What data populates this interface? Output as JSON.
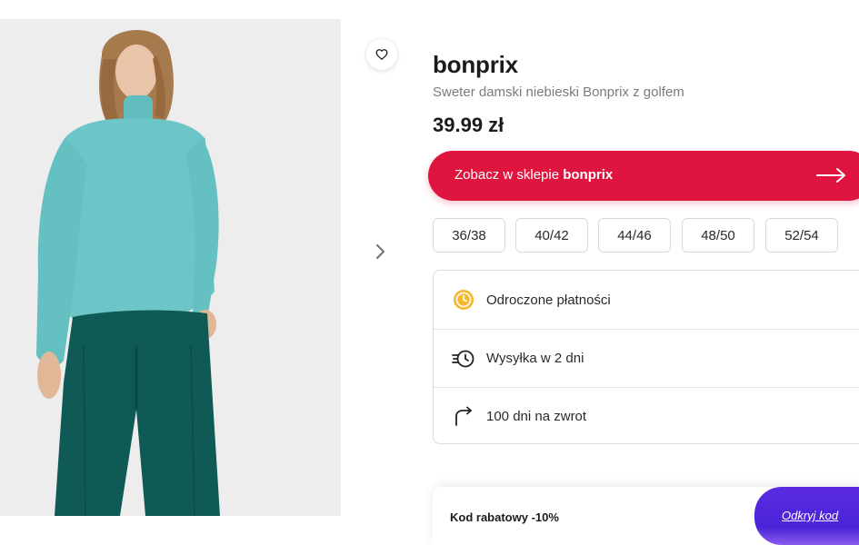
{
  "product": {
    "brand": "bonprix",
    "name": "Sweter damski niebieski Bonprix z golfem",
    "price": "39.99 zł"
  },
  "shop_button": {
    "prefix": "Zobacz w sklepie",
    "shop": "bonprix",
    "icon": "arrow-right-icon"
  },
  "sizes": [
    "36/38",
    "40/42",
    "44/46",
    "48/50",
    "52/54"
  ],
  "features": [
    {
      "label": "Odroczone płatności",
      "icon": "clock-coin-icon"
    },
    {
      "label": "Wysyłka w 2 dni",
      "icon": "fast-delivery-icon"
    },
    {
      "label": "100 dni na zwrot",
      "icon": "return-arrow-icon"
    }
  ],
  "promo": {
    "label": "Kod rabatowy -10%",
    "button": "Odkryj kod"
  },
  "colors": {
    "accent": "#e0153f",
    "promo_gradient": "#4a23d6",
    "sweater": "#6cc6c7",
    "trousers": "#0f5a55"
  },
  "icons": {
    "favorite": "heart-icon",
    "next_image": "chevron-right-icon"
  }
}
